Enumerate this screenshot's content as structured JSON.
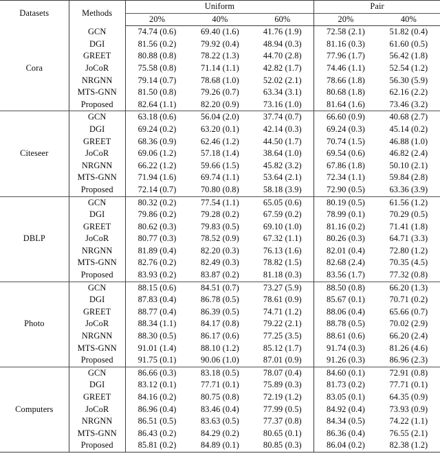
{
  "table": {
    "columns": {
      "datasets_label": "Datasets",
      "methods_label": "Methods",
      "groups": [
        {
          "label": "Uniform",
          "rates": [
            "20%",
            "40%",
            "60%"
          ]
        },
        {
          "label": "Pair",
          "rates": [
            "20%",
            "40%"
          ]
        }
      ]
    },
    "sections": [
      {
        "dataset": "Cora",
        "rows": [
          {
            "method": "GCN",
            "method_bold": false,
            "values": [
              "74.74 (0.6)",
              "69.40 (1.6)",
              "41.76 (1.9)",
              "72.58 (2.1)",
              "51.82 (0.4)"
            ],
            "bold": [
              false,
              false,
              false,
              false,
              false
            ]
          },
          {
            "method": "DGI",
            "method_bold": false,
            "values": [
              "81.56 (0.2)",
              "79.92 (0.4)",
              "48.94 (0.3)",
              "81.16 (0.3)",
              "61.60 (0.5)"
            ],
            "bold": [
              false,
              false,
              false,
              false,
              false
            ]
          },
          {
            "method": "GREET",
            "method_bold": false,
            "values": [
              "80.88 (0.8)",
              "78.22 (1.3)",
              "44.70 (2.8)",
              "77.96 (1.7)",
              "56.42 (1.8)"
            ],
            "bold": [
              false,
              false,
              false,
              false,
              false
            ]
          },
          {
            "method": "JoCoR",
            "method_bold": false,
            "values": [
              "75.58 (0.8)",
              "71.14 (1.1)",
              "42.82 (1.7)",
              "74.46 (1.1)",
              "52.54 (1.2)"
            ],
            "bold": [
              false,
              false,
              false,
              false,
              false
            ]
          },
          {
            "method": "NRGNN",
            "method_bold": false,
            "values": [
              "79.14 (0.7)",
              "78.68 (1.0)",
              "52.02 (2.1)",
              "78.66 (1.8)",
              "56.30 (5.9)"
            ],
            "bold": [
              false,
              false,
              false,
              false,
              false
            ]
          },
          {
            "method": "MTS-GNN",
            "method_bold": false,
            "values": [
              "81.50 (0.8)",
              "79.26 (0.7)",
              "63.34 (3.1)",
              "80.68 (1.8)",
              "62.16 (2.2)"
            ],
            "bold": [
              false,
              false,
              false,
              false,
              false
            ]
          },
          {
            "method": "Proposed",
            "method_bold": true,
            "values": [
              "82.64 (1.1)",
              "82.20 (0.9)",
              "73.16 (1.0)",
              "81.64 (1.6)",
              "73.46 (3.2)"
            ],
            "bold": [
              true,
              true,
              true,
              true,
              true
            ]
          }
        ]
      },
      {
        "dataset": "Citeseer",
        "rows": [
          {
            "method": "GCN",
            "method_bold": false,
            "values": [
              "63.18 (0.6)",
              "56.04 (2.0)",
              "37.74 (0.7)",
              "66.60 (0.9)",
              "40.68 (2.7)"
            ],
            "bold": [
              false,
              false,
              false,
              false,
              false
            ]
          },
          {
            "method": "DGI",
            "method_bold": false,
            "values": [
              "69.24 (0.2)",
              "63.20 (0.1)",
              "42.14 (0.3)",
              "69.24 (0.3)",
              "45.14 (0.2)"
            ],
            "bold": [
              false,
              false,
              false,
              false,
              false
            ]
          },
          {
            "method": "GREET",
            "method_bold": false,
            "values": [
              "68.36 (0.9)",
              "62.46 (1.2)",
              "44.50 (1.7)",
              "70.74 (1.5)",
              "46.88 (1.0)"
            ],
            "bold": [
              false,
              false,
              false,
              false,
              false
            ]
          },
          {
            "method": "JoCoR",
            "method_bold": false,
            "values": [
              "69.06 (1.2)",
              "57.18 (1.4)",
              "38.64 (1.0)",
              "69.54 (0.6)",
              "46.82 (2.4)"
            ],
            "bold": [
              false,
              false,
              false,
              false,
              false
            ]
          },
          {
            "method": "NRGNN",
            "method_bold": false,
            "values": [
              "66.22 (1.2)",
              "59.66 (1.5)",
              "45.82 (3.2)",
              "67.86 (1.8)",
              "50.10 (2.1)"
            ],
            "bold": [
              false,
              false,
              false,
              false,
              false
            ]
          },
          {
            "method": "MTS-GNN",
            "method_bold": false,
            "values": [
              "71.94 (1.6)",
              "69.74 (1.1)",
              "53.64 (2.1)",
              "72.34 (1.1)",
              "59.84 (2.8)"
            ],
            "bold": [
              false,
              false,
              false,
              false,
              false
            ]
          },
          {
            "method": "Proposed",
            "method_bold": true,
            "values": [
              "72.14 (0.7)",
              "70.80 (0.8)",
              "58.18 (3.9)",
              "72.90 (0.5)",
              "63.36 (3.9)"
            ],
            "bold": [
              true,
              true,
              true,
              true,
              true
            ]
          }
        ]
      },
      {
        "dataset": "DBLP",
        "rows": [
          {
            "method": "GCN",
            "method_bold": false,
            "values": [
              "80.32 (0.2)",
              "77.54 (1.1)",
              "65.05 (0.6)",
              "80.19 (0.5)",
              "61.56 (1.2)"
            ],
            "bold": [
              false,
              false,
              false,
              false,
              false
            ]
          },
          {
            "method": "DGI",
            "method_bold": false,
            "values": [
              "79.86 (0.2)",
              "79.28 (0.2)",
              "67.59 (0.2)",
              "78.99 (0.1)",
              "70.29 (0.5)"
            ],
            "bold": [
              false,
              false,
              false,
              false,
              false
            ]
          },
          {
            "method": "GREET",
            "method_bold": false,
            "values": [
              "80.62 (0.3)",
              "79.83 (0.5)",
              "69.10 (1.0)",
              "81.16 (0.2)",
              "71.41 (1.8)"
            ],
            "bold": [
              false,
              false,
              false,
              false,
              false
            ]
          },
          {
            "method": "JoCoR",
            "method_bold": false,
            "values": [
              "80.77 (0.3)",
              "78.52 (0.9)",
              "67.32 (1.1)",
              "80.26 (0.3)",
              "64.71 (3.3)"
            ],
            "bold": [
              false,
              false,
              false,
              false,
              false
            ]
          },
          {
            "method": "NRGNN",
            "method_bold": false,
            "values": [
              "81.89 (0.4)",
              "82.20 (0.3)",
              "76.13 (1.6)",
              "82.01 (0.4)",
              "72.80 (1.2)"
            ],
            "bold": [
              false,
              false,
              false,
              false,
              false
            ]
          },
          {
            "method": "MTS-GNN",
            "method_bold": false,
            "values": [
              "82.76 (0.2)",
              "82.49 (0.3)",
              "78.82 (1.5)",
              "82.68 (2.4)",
              "70.35 (4.5)"
            ],
            "bold": [
              false,
              false,
              false,
              false,
              false
            ]
          },
          {
            "method": "Proposed",
            "method_bold": true,
            "values": [
              "83.93 (0.2)",
              "83.87 (0.2)",
              "81.18 (0.3)",
              "83.56 (1.7)",
              "77.32 (0.8)"
            ],
            "bold": [
              true,
              true,
              true,
              true,
              true
            ]
          }
        ]
      },
      {
        "dataset": "Photo",
        "rows": [
          {
            "method": "GCN",
            "method_bold": false,
            "values": [
              "88.15 (0.6)",
              "84.51 (0.7)",
              "73.27 (5.9)",
              "88.50 (0.8)",
              "66.20 (1.3)"
            ],
            "bold": [
              false,
              false,
              false,
              false,
              false
            ]
          },
          {
            "method": "DGI",
            "method_bold": false,
            "values": [
              "87.83 (0.4)",
              "86.78 (0.5)",
              "78.61 (0.9)",
              "85.67 (0.1)",
              "70.71 (0.2)"
            ],
            "bold": [
              false,
              false,
              false,
              false,
              false
            ]
          },
          {
            "method": "GREET",
            "method_bold": false,
            "values": [
              "88.77 (0.4)",
              "86.39 (0.5)",
              "74.71 (1.2)",
              "88.06 (0.4)",
              "65.66 (0.7)"
            ],
            "bold": [
              false,
              false,
              false,
              false,
              false
            ]
          },
          {
            "method": "JoCoR",
            "method_bold": false,
            "values": [
              "88.34 (1.1)",
              "84.17 (0.8)",
              "79.22 (2.1)",
              "88.78 (0.5)",
              "70.02 (2.9)"
            ],
            "bold": [
              false,
              false,
              false,
              false,
              false
            ]
          },
          {
            "method": "NRGNN",
            "method_bold": false,
            "values": [
              "88.30 (0.5)",
              "86.17 (0.6)",
              "77.25 (3.5)",
              "88.61 (0.6)",
              "66.20 (2.4)"
            ],
            "bold": [
              false,
              false,
              false,
              false,
              false
            ]
          },
          {
            "method": "MTS-GNN",
            "method_bold": false,
            "values": [
              "91.01 (1.4)",
              "88.10 (1.2)",
              "85.12 (1.7)",
              "91.74 (0.3)",
              "81.26 (4.6)"
            ],
            "bold": [
              false,
              false,
              false,
              true,
              false
            ]
          },
          {
            "method": "Proposed",
            "method_bold": true,
            "values": [
              "91.75 (0.1)",
              "90.06 (1.0)",
              "87.01 (0.9)",
              "91.26 (0.3)",
              "86.96 (2.3)"
            ],
            "bold": [
              true,
              true,
              true,
              false,
              true
            ]
          }
        ]
      },
      {
        "dataset": "Computers",
        "rows": [
          {
            "method": "GCN",
            "method_bold": false,
            "values": [
              "86.66 (0.3)",
              "83.18 (0.5)",
              "78.07 (0.4)",
              "84.60 (0.1)",
              "72.91 (0.8)"
            ],
            "bold": [
              false,
              false,
              false,
              false,
              false
            ]
          },
          {
            "method": "DGI",
            "method_bold": false,
            "values": [
              "83.12 (0.1)",
              "77.71 (0.1)",
              "75.89 (0.3)",
              "81.73 (0.2)",
              "77.71 (0.1)"
            ],
            "bold": [
              false,
              false,
              false,
              false,
              false
            ]
          },
          {
            "method": "GREET",
            "method_bold": false,
            "values": [
              "84.16 (0.2)",
              "80.75 (0.8)",
              "72.19 (1.2)",
              "83.05 (0.1)",
              "64.35 (0.9)"
            ],
            "bold": [
              false,
              false,
              false,
              false,
              false
            ]
          },
          {
            "method": "JoCoR",
            "method_bold": false,
            "values": [
              "86.96 (0.4)",
              "83.46 (0.4)",
              "77.99 (0.5)",
              "84.92 (0.4)",
              "73.93 (0.9)"
            ],
            "bold": [
              true,
              false,
              false,
              false,
              false
            ]
          },
          {
            "method": "NRGNN",
            "method_bold": false,
            "values": [
              "86.51 (0.5)",
              "83.63 (0.5)",
              "77.37 (0.8)",
              "84.34 (0.5)",
              "74.22 (1.1)"
            ],
            "bold": [
              false,
              false,
              false,
              false,
              false
            ]
          },
          {
            "method": "MTS-GNN",
            "method_bold": false,
            "values": [
              "86.43 (0.2)",
              "84.29 (0.2)",
              "80.65 (0.1)",
              "86.36 (0.4)",
              "76.55 (2.1)"
            ],
            "bold": [
              false,
              false,
              false,
              true,
              false
            ]
          },
          {
            "method": "Proposed",
            "method_bold": true,
            "values": [
              "85.81 (0.2)",
              "84.89 (0.1)",
              "80.85 (0.3)",
              "86.04 (0.2)",
              "82.38 (1.2)"
            ],
            "bold": [
              false,
              true,
              true,
              false,
              true
            ]
          }
        ]
      }
    ]
  }
}
